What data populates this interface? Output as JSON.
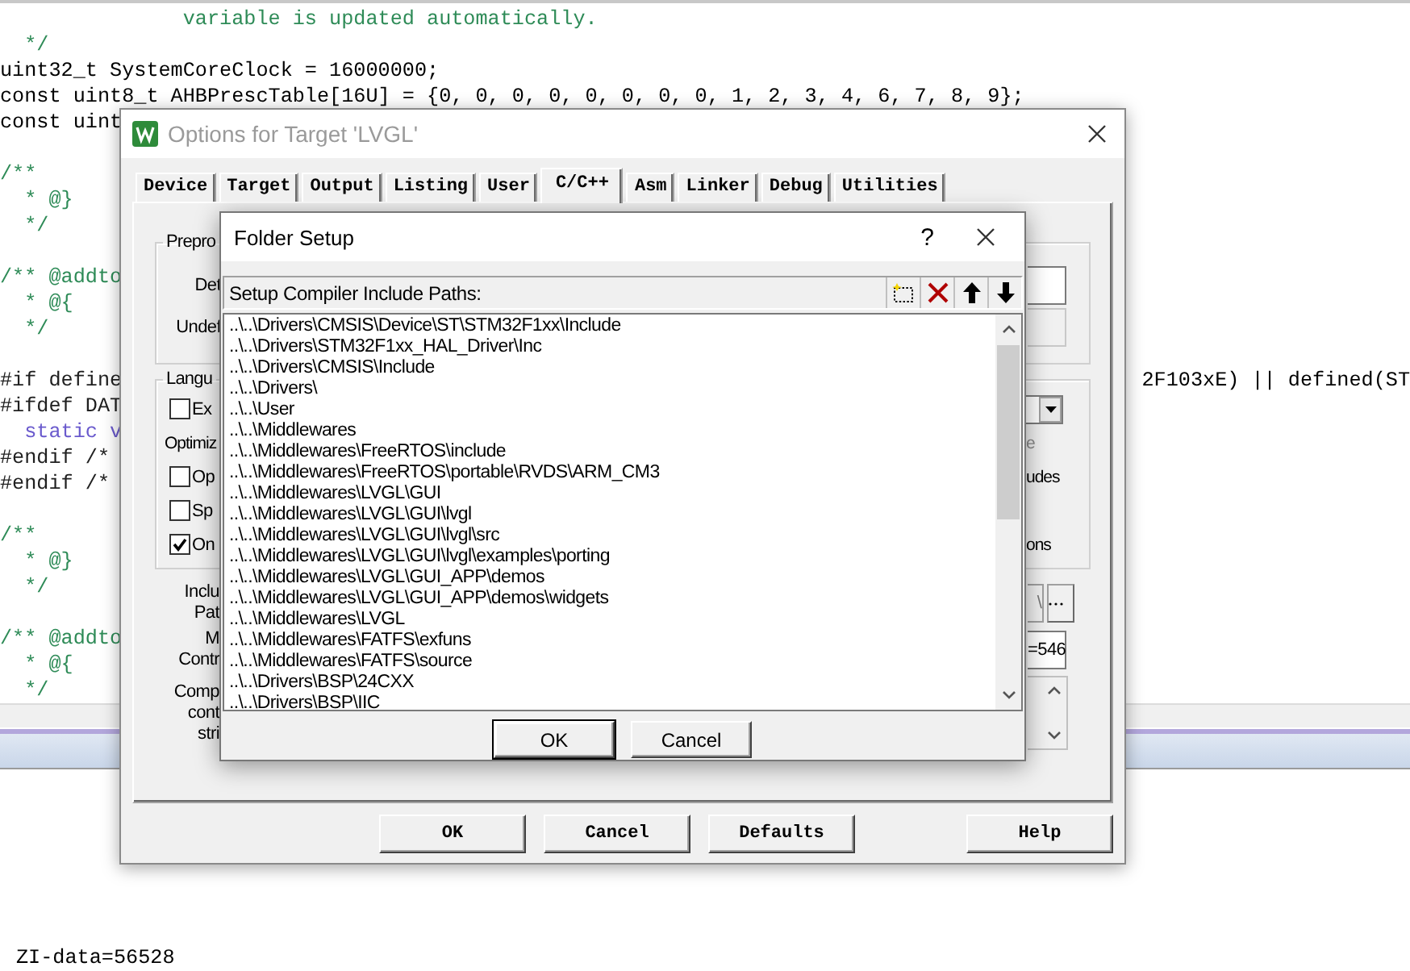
{
  "editor": {
    "lines": [
      {
        "kind": "comment",
        "text": "               variable is updated automatically."
      },
      {
        "kind": "comment",
        "text": "  */"
      },
      {
        "kind": "code",
        "text": "uint32_t SystemCoreClock = 16000000;"
      },
      {
        "kind": "code",
        "text": "const uint8_t AHBPrescTable[16U] = {0, 0, 0, 0, 0, 0, 0, 0, 1, 2, 3, 4, 6, 7, 8, 9};"
      },
      {
        "kind": "code",
        "text": "const uint"
      },
      {
        "kind": "blank"
      },
      {
        "kind": "comment",
        "text": "/**"
      },
      {
        "kind": "comment",
        "text": "  * @}"
      },
      {
        "kind": "comment",
        "text": "  */"
      },
      {
        "kind": "blank"
      },
      {
        "kind": "comment",
        "text": "/** @addto"
      },
      {
        "kind": "comment",
        "text": "  * @{"
      },
      {
        "kind": "comment",
        "text": "  */"
      },
      {
        "kind": "blank"
      },
      {
        "kind": "preproc",
        "text": "#if define",
        "tail": "2F103xE) || defined(ST"
      },
      {
        "kind": "preproc",
        "text": "#ifdef DAT"
      },
      {
        "kind": "static",
        "text": "  static v"
      },
      {
        "kind": "preproc",
        "text": "#endif /*"
      },
      {
        "kind": "preproc",
        "text": "#endif /*"
      },
      {
        "kind": "blank"
      },
      {
        "kind": "comment",
        "text": "/**"
      },
      {
        "kind": "comment",
        "text": "  * @}"
      },
      {
        "kind": "comment",
        "text": "  */"
      },
      {
        "kind": "blank"
      },
      {
        "kind": "comment",
        "text": "/** @addto"
      },
      {
        "kind": "comment",
        "text": "  * @{"
      },
      {
        "kind": "comment",
        "text": "  */"
      }
    ],
    "output_text": "ZI-data=56528"
  },
  "options_dialog": {
    "title": "Options for Target 'LVGL'",
    "tabs": [
      {
        "label": "Device",
        "selected": false
      },
      {
        "label": "Target",
        "selected": false
      },
      {
        "label": "Output",
        "selected": false
      },
      {
        "label": "Listing",
        "selected": false
      },
      {
        "label": "User",
        "selected": false
      },
      {
        "label": "C/C++",
        "selected": true
      },
      {
        "label": "Asm",
        "selected": false
      },
      {
        "label": "Linker",
        "selected": false
      },
      {
        "label": "Debug",
        "selected": false
      },
      {
        "label": "Utilities",
        "selected": false
      }
    ],
    "preprocessor": {
      "legend": "Prepro",
      "rows": [
        {
          "label": "Det",
          "disabled": false
        },
        {
          "label": "Undef",
          "disabled": true
        }
      ]
    },
    "language": {
      "legend": "Langu",
      "rows": [
        {
          "kind": "checkbox",
          "label": "Ex",
          "checked": false,
          "right": {
            "kind": "dropdown"
          }
        },
        {
          "kind": "label",
          "label": "Optimiz",
          "right": {
            "kind": "label",
            "text": "e",
            "disabled": true
          }
        },
        {
          "kind": "checkbox",
          "label": "Op",
          "checked": false,
          "right": {
            "kind": "label",
            "text": "udes",
            "disabled": false
          }
        },
        {
          "kind": "checkbox",
          "label": "Sp",
          "checked": false
        },
        {
          "kind": "checkbox",
          "label": "On",
          "checked": true,
          "right": {
            "kind": "label",
            "text": "ons",
            "disabled": false
          }
        }
      ]
    },
    "misc": [
      {
        "kind": "path_field",
        "labels": [
          "Inclu",
          "Pat"
        ],
        "value": "\\"
      },
      {
        "kind": "text_field",
        "labels": [
          "M",
          "Contr"
        ],
        "value": "=546"
      },
      {
        "kind": "text_area",
        "labels": [
          "Comp",
          "cont",
          "stri"
        ]
      }
    ],
    "buttons": [
      "OK",
      "Cancel",
      "Defaults",
      "Help"
    ]
  },
  "folder_setup": {
    "title": "Folder Setup",
    "help": "?",
    "header": "Setup Compiler Include Paths:",
    "paths": [
      "..\\..\\Drivers\\CMSIS\\Device\\ST\\STM32F1xx\\Include",
      "..\\..\\Drivers\\STM32F1xx_HAL_Driver\\Inc",
      "..\\..\\Drivers\\CMSIS\\Include",
      "..\\..\\Drivers\\",
      "..\\..\\User",
      "..\\..\\Middlewares",
      "..\\..\\Middlewares\\FreeRTOS\\include",
      "..\\..\\Middlewares\\FreeRTOS\\portable\\RVDS\\ARM_CM3",
      "..\\..\\Middlewares\\LVGL\\GUI",
      "..\\..\\Middlewares\\LVGL\\GUI\\lvgl",
      "..\\..\\Middlewares\\LVGL\\GUI\\lvgl\\src",
      "..\\..\\Middlewares\\LVGL\\GUI\\lvgl\\examples\\porting",
      "..\\..\\Middlewares\\LVGL\\GUI_APP\\demos",
      "..\\..\\Middlewares\\LVGL\\GUI_APP\\demos\\widgets",
      "..\\..\\Middlewares\\LVGL",
      "..\\..\\Middlewares\\FATFS\\exfuns",
      "..\\..\\Middlewares\\FATFS\\source",
      "..\\..\\Drivers\\BSP\\24CXX",
      "..\\..\\Drivers\\BSP\\IIC"
    ],
    "buttons": [
      {
        "label": "OK",
        "default": true
      },
      {
        "label": "Cancel",
        "default": false
      }
    ]
  }
}
